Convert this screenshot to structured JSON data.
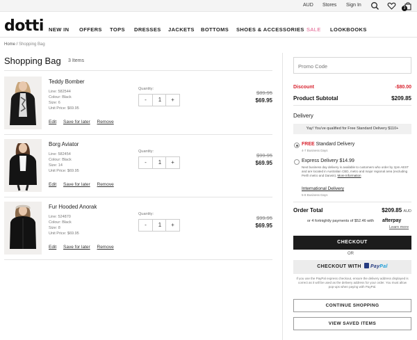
{
  "topbar": {
    "currency": "AUD",
    "stores": "Stores",
    "signin": "Sign In",
    "cart_count": "3"
  },
  "brand": {
    "logo": "dotti"
  },
  "nav": [
    "NEW IN",
    "OFFERS",
    "TOPS",
    "DRESSES",
    "JACKETS",
    "BOTTOMS",
    "SHOES & ACCESSORIES",
    "SALE",
    "LOOKBOOKS"
  ],
  "breadcrumb": {
    "home": "Home /",
    "current": "Shopping Bag"
  },
  "bag": {
    "title": "Shopping Bag",
    "count": "3 Items"
  },
  "items": [
    {
      "name": "Teddy Bomber",
      "line": "Line: 582544",
      "colour": "Colour: Black",
      "size": "Size: 6",
      "unit": "Unit Price: $69.95",
      "qty_label": "Quantity:",
      "qty": "1",
      "was": "$89.95",
      "now": "$69.95",
      "edit": "Edit",
      "save": "Save for later",
      "remove": "Remove"
    },
    {
      "name": "Borg Aviator",
      "line": "Line: 582454",
      "colour": "Colour: Black",
      "size": "Size: 14",
      "unit": "Unit Price: $69.95",
      "qty_label": "Quantity:",
      "qty": "1",
      "was": "$99.95",
      "now": "$69.95",
      "edit": "Edit",
      "save": "Save for later",
      "remove": "Remove"
    },
    {
      "name": "Fur Hooded Anorak",
      "line": "Line: 524870",
      "colour": "Colour: Black",
      "size": "Size: 8",
      "unit": "Unit Price: $69.95",
      "qty_label": "Quantity:",
      "qty": "1",
      "was": "$99.95",
      "now": "$69.95",
      "edit": "Edit",
      "save": "Save for later",
      "remove": "Remove"
    }
  ],
  "qty_controls": {
    "minus": "-",
    "plus": "+"
  },
  "summary": {
    "promo_placeholder": "Promo Code",
    "discount_label": "Discount",
    "discount_value": "-$80.00",
    "subtotal_label": "Product Subtotal",
    "subtotal_value": "$209.85",
    "delivery_heading": "Delivery",
    "free_banner": "Yay! You've qualified for Free Standard Delivery $110+",
    "free_tag": "FREE",
    "standard": "Standard Delivery",
    "standard_days": "4-7 Business Days",
    "express": "Express Delivery $14.99",
    "express_note": "Next business day delivery is available to customers who order by 2pm AEST and are located in Australian CBD, metro and major regional area (excluding Perth metro and Darwin).",
    "express_more": "More Information",
    "intl": "International Delivery",
    "intl_days": "5-8 Business Days",
    "order_total_label": "Order Total",
    "order_total_value": "$209.85",
    "currency": "AUD",
    "afterpay_text": "or 4 fortnightly payments of $52.46 with",
    "afterpay_brand": "afterpay",
    "learn_more": "Learn more",
    "checkout": "CHECKOUT",
    "or": "OR",
    "checkout_with": "CHECKOUT WITH",
    "paypal_pay": "Pay",
    "paypal_pal": "Pal",
    "paypal_note": "If you use the PayPal express checkout, ensure the delivery address displayed is correct as it will be used as the delivery address for your order. You must allow pop-ups when paying with PayPal.",
    "continue": "CONTINUE SHOPPING",
    "saved": "VIEW SAVED ITEMS"
  },
  "colors": {
    "discount": "#d8222e",
    "sale": "#e05a8a",
    "checkout_bg": "#1c1c1c",
    "paypal_dark": "#253b80",
    "paypal_light": "#179bd7"
  }
}
